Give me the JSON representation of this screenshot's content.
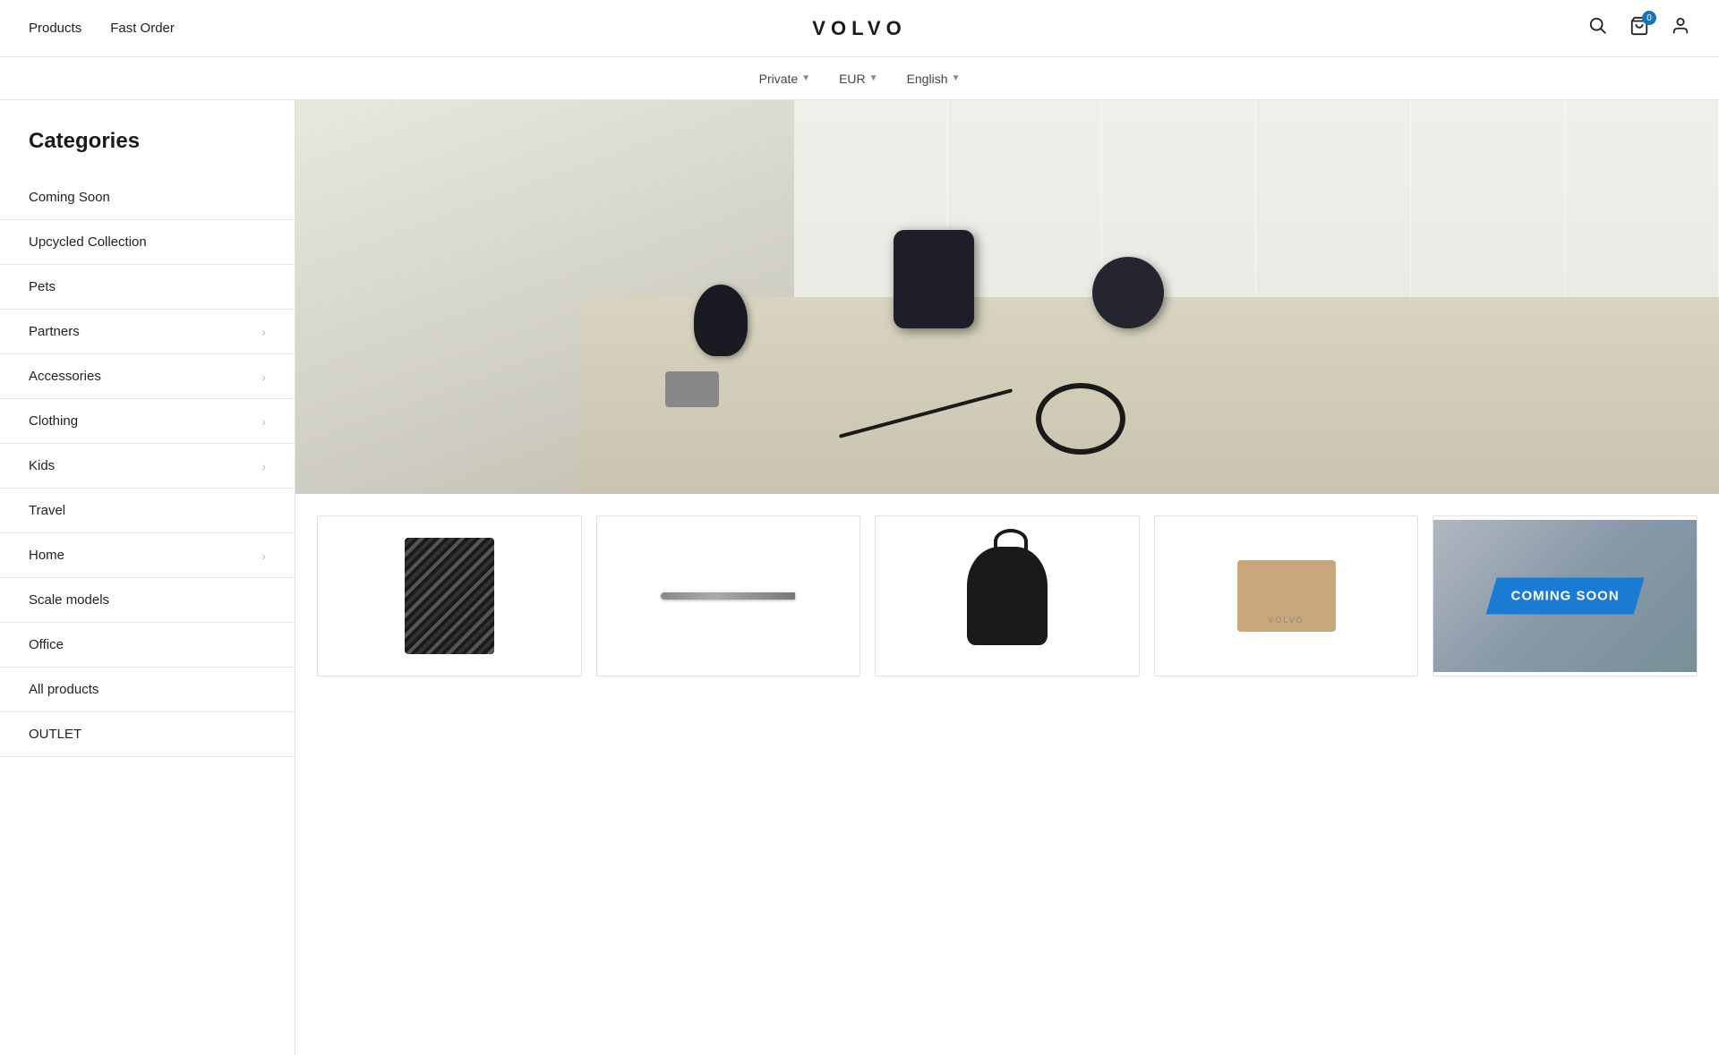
{
  "topNav": {
    "products_label": "Products",
    "fast_order_label": "Fast Order",
    "logo_text": "VOLVO",
    "cart_count": "0"
  },
  "subNav": {
    "private_label": "Private",
    "currency_label": "EUR",
    "language_label": "English"
  },
  "sidebar": {
    "title": "Categories",
    "items": [
      {
        "label": "Coming Soon",
        "has_arrow": false
      },
      {
        "label": "Upcycled Collection",
        "has_arrow": false
      },
      {
        "label": "Pets",
        "has_arrow": false
      },
      {
        "label": "Partners",
        "has_arrow": true
      },
      {
        "label": "Accessories",
        "has_arrow": true
      },
      {
        "label": "Clothing",
        "has_arrow": true
      },
      {
        "label": "Kids",
        "has_arrow": true
      },
      {
        "label": "Travel",
        "has_arrow": false
      },
      {
        "label": "Home",
        "has_arrow": true
      },
      {
        "label": "Scale models",
        "has_arrow": false
      },
      {
        "label": "Office",
        "has_arrow": false
      },
      {
        "label": "All products",
        "has_arrow": false
      },
      {
        "label": "OUTLET",
        "has_arrow": false
      }
    ]
  },
  "productCards": [
    {
      "id": "scarf",
      "type": "scarf"
    },
    {
      "id": "pen",
      "type": "pen"
    },
    {
      "id": "bag",
      "type": "bag"
    },
    {
      "id": "box",
      "type": "box"
    },
    {
      "id": "coming-soon",
      "type": "coming-soon",
      "banner_text": "COMING SOON"
    }
  ]
}
